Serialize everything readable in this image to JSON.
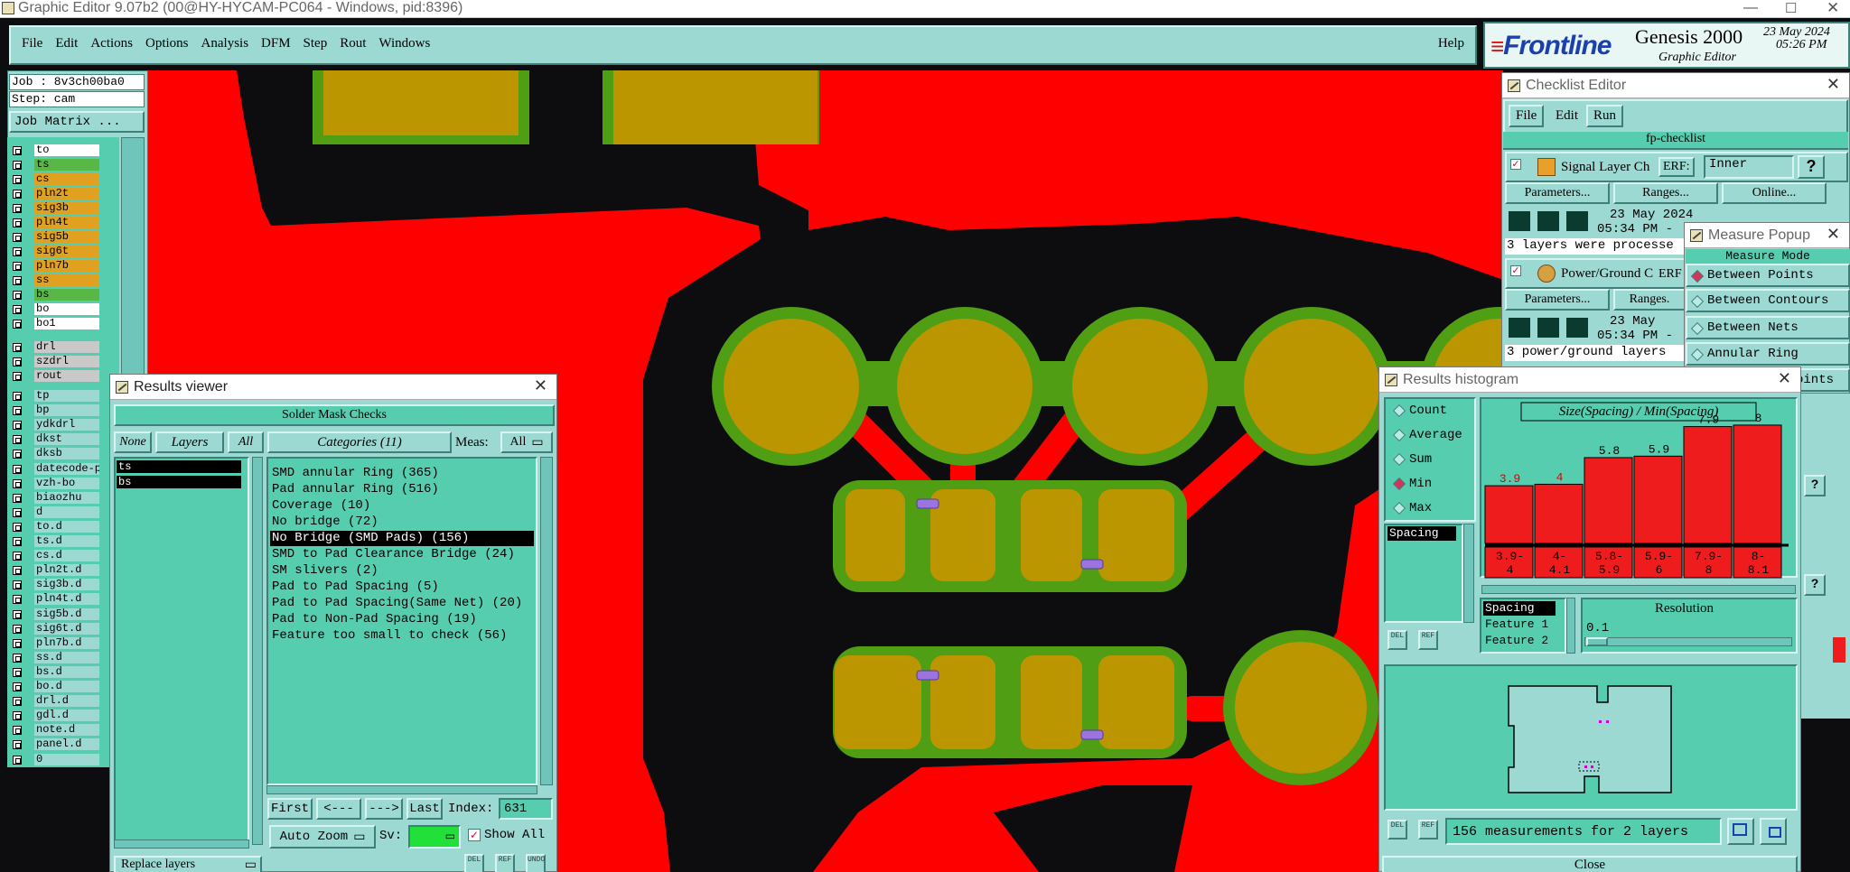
{
  "window_title": "Graphic Editor 9.07b2 (00@HY-HYCAM-PC064 - Windows, pid:8396)",
  "menubar": [
    "File",
    "Edit",
    "Actions",
    "Options",
    "Analysis",
    "DFM",
    "Step",
    "Rout",
    "Windows"
  ],
  "help_label": "Help",
  "brand": {
    "logo": "Frontline",
    "product": "Genesis 2000",
    "subtitle": "Graphic Editor",
    "date": "23 May 2024",
    "time": "05:26 PM"
  },
  "job": {
    "job_label": "Job : 8v3ch00ba0",
    "step_label": "Step: cam",
    "matrix_button": "Job Matrix ..."
  },
  "layers_group1": [
    {
      "name": "to",
      "color": "#ffffff"
    },
    {
      "name": "ts",
      "color": "#57b846"
    },
    {
      "name": "cs",
      "color": "#e0a020"
    },
    {
      "name": "pln2t",
      "color": "#e0a020"
    },
    {
      "name": "sig3b",
      "color": "#e0a020"
    },
    {
      "name": "pln4t",
      "color": "#e0a020"
    },
    {
      "name": "sig5b",
      "color": "#e0a020"
    },
    {
      "name": "sig6t",
      "color": "#e0a020"
    },
    {
      "name": "pln7b",
      "color": "#e0a020"
    },
    {
      "name": "ss",
      "color": "#e0a020"
    },
    {
      "name": "bs",
      "color": "#57b846"
    },
    {
      "name": "bo",
      "color": "#ffffff"
    },
    {
      "name": "bo1",
      "color": "#ffffff"
    }
  ],
  "layers_group2": [
    "drl",
    "szdrl",
    "rout"
  ],
  "layers_group3": [
    "tp",
    "bp",
    "ydkdrl",
    "dkst",
    "dksb",
    "datecode-p",
    "vzh-bo",
    "biaozhu",
    "d",
    "to.d",
    "ts.d",
    "cs.d",
    "pln2t.d",
    "sig3b.d",
    "pln4t.d",
    "sig5b.d",
    "sig6t.d",
    "pln7b.d",
    "ss.d",
    "bs.d",
    "bo.d",
    "drl.d",
    "gdl.d",
    "note.d",
    "panel.d",
    "0"
  ],
  "results_viewer": {
    "title": "Results viewer",
    "header": "Solder Mask Checks",
    "none_btn": "None",
    "layers_label": "Layers",
    "all_btn": "All",
    "layers": [
      "ts",
      "bs"
    ],
    "categories_label": "Categories (11)",
    "meas_label": "Meas:",
    "meas_value": "All",
    "categories": [
      "SMD annular Ring (365)",
      "Pad annular Ring (516)",
      "Coverage (10)",
      "No bridge (72)",
      "No Bridge (SMD Pads) (156)",
      "SMD to Pad Clearance Bridge (24)",
      "SM slivers (2)",
      "Pad to Pad Spacing (5)",
      "Pad to Pad Spacing(Same Net) (20)",
      "Pad to Non-Pad Spacing (19)",
      "Feature too small to check (56)"
    ],
    "selected_category": 4,
    "nav": {
      "first": "First",
      "prev": "<---",
      "next": "--->",
      "last": "Last",
      "index_label": "Index:",
      "index_value": "631"
    },
    "auto_zoom": "Auto Zoom",
    "sv_label": "Sv:",
    "show_all": "Show All",
    "replace_layers": "Replace layers",
    "mini_buttons": [
      "DEL",
      "REF",
      "UNDO"
    ]
  },
  "checklist": {
    "title": "Checklist Editor",
    "menu": [
      "File",
      "Edit",
      "Run"
    ],
    "name": "fp-checklist",
    "checks": [
      {
        "name": "Signal Layer Ch",
        "erf_label": "ERF:",
        "erf_value": "Inner",
        "buttons": [
          "Parameters...",
          "Ranges...",
          "Online..."
        ],
        "date": "23 May 2024",
        "time": "05:34 PM -",
        "status": "3 layers were processe"
      },
      {
        "name": "Power/Ground C",
        "erf_label": "ERF",
        "buttons": [
          "Parameters...",
          "Ranges."
        ],
        "date": "23 May",
        "time": "05:34 PM -",
        "status": "3 power/ground layers"
      }
    ]
  },
  "measure_popup": {
    "title": "Measure Popup",
    "header": "Measure Mode",
    "modes": [
      "Between Points",
      "Between Contours",
      "Between Nets",
      "Annular Ring",
      "oints"
    ],
    "selected": 0
  },
  "histogram": {
    "title": "Results histogram",
    "options": [
      "Count",
      "Average",
      "Sum",
      "Min",
      "Max"
    ],
    "selected_option": 3,
    "list_label": "Spacing",
    "chart_title": "Size(Spacing) / Min(Spacing)",
    "color": "#ee1c1c",
    "feature_list": [
      "Spacing",
      "Feature 1",
      "Feature 2"
    ],
    "resolution_label": "Resolution",
    "resolution_value": "0.1",
    "footer_text": "156 measurements for 2 layers",
    "close_label": "Close",
    "mini_buttons": [
      "DEL",
      "REF"
    ]
  },
  "chart_data": {
    "type": "bar",
    "title": "Size(Spacing) / Min(Spacing)",
    "categories": [
      "3.9-4",
      "4-4.1",
      "5.8-5.9",
      "5.9-6",
      "7.9-8",
      "8-8.1"
    ],
    "values": [
      3.9,
      4,
      5.8,
      5.9,
      7.9,
      8
    ],
    "data_labels": [
      "3.9",
      "4",
      "5.8",
      "5.9",
      "7.9",
      "8"
    ],
    "ylim": [
      0,
      8.3
    ],
    "grid": false,
    "bar_color": "#ee1c1c"
  },
  "canvas_colors": {
    "background": "#0d0d10",
    "copper": "#ff0000",
    "pad": "#bb9600",
    "mask": "#4f9e14",
    "marker": "#9b74e0"
  }
}
